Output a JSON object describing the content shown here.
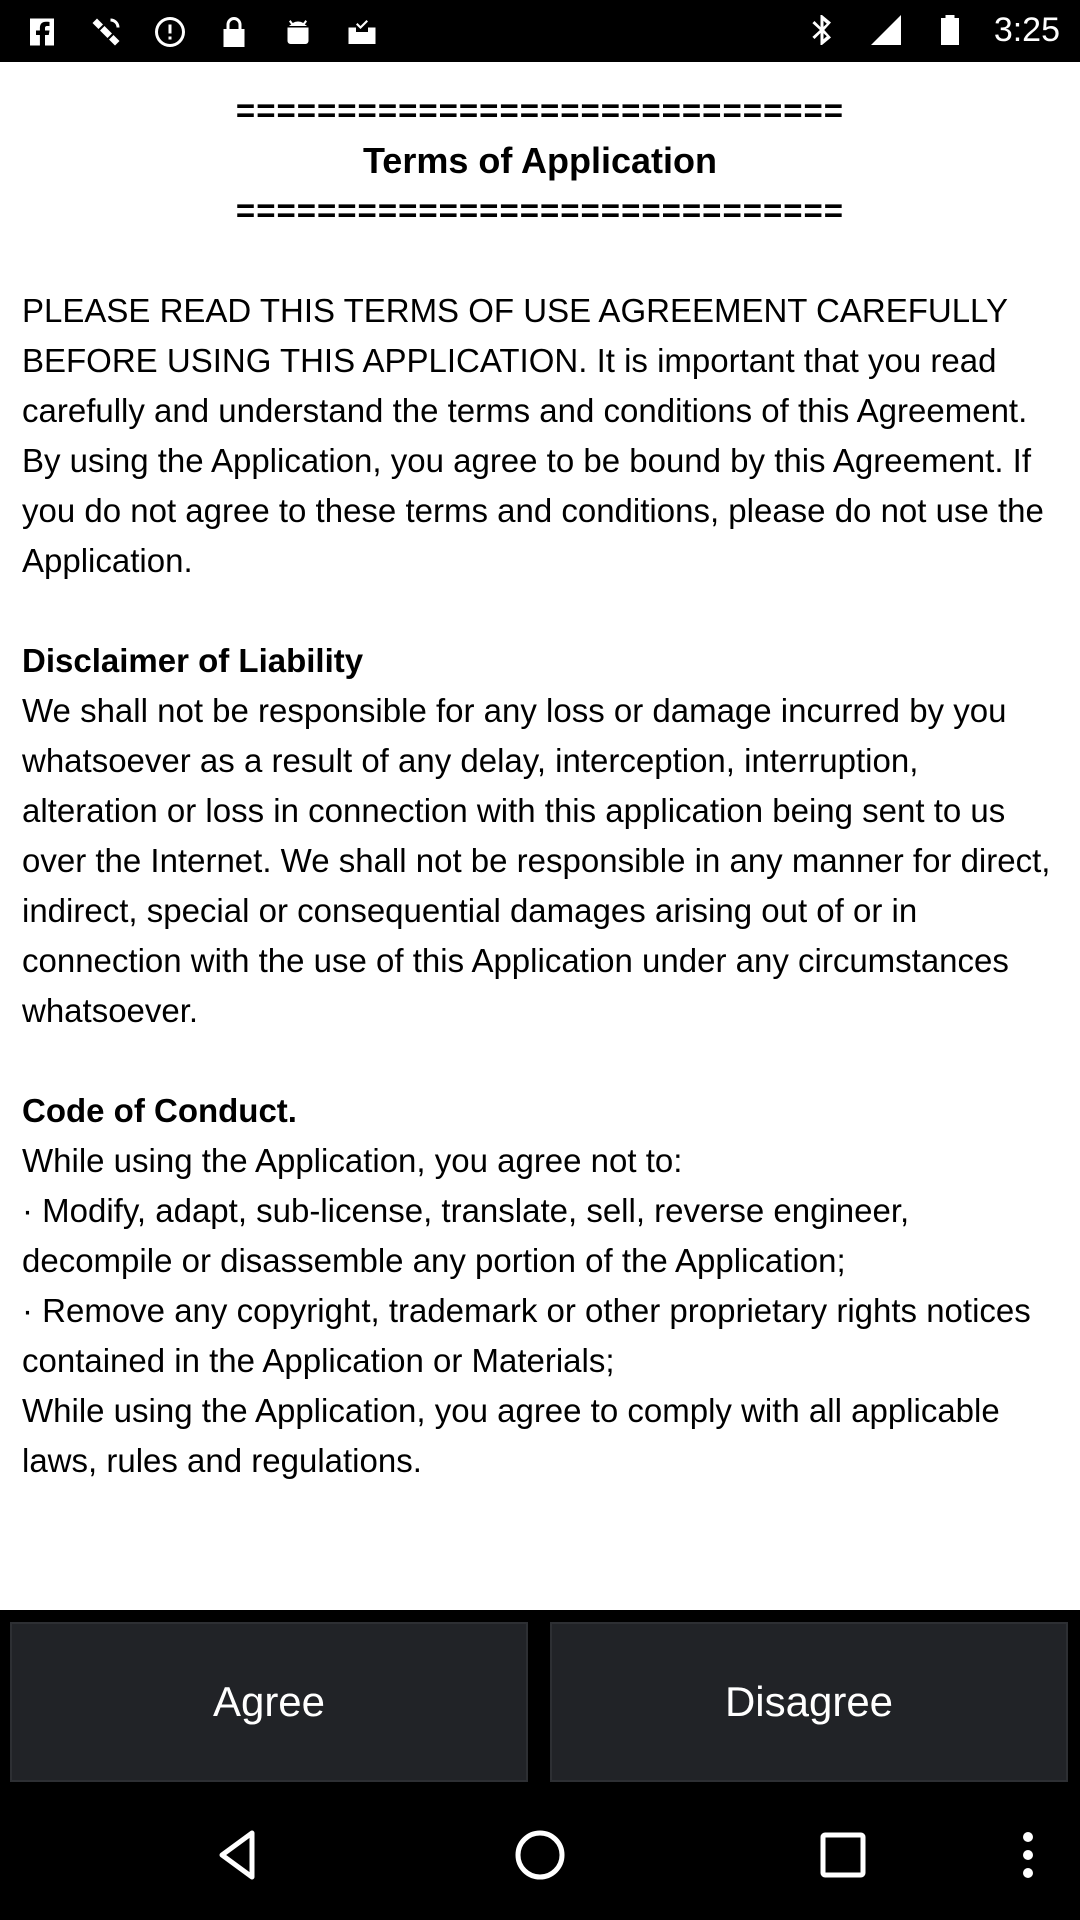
{
  "status_bar": {
    "time": "3:25",
    "left_icons": [
      "facebook-icon",
      "satellite-icon",
      "alert-circle-icon",
      "lock-icon",
      "android-icon",
      "inbox-check-icon"
    ],
    "right_icons": [
      "bluetooth-icon",
      "signal-icon",
      "battery-icon"
    ]
  },
  "document": {
    "separator_top": "==============================",
    "title": "Terms of Application",
    "separator_bottom": "==============================",
    "intro": "PLEASE READ THIS TERMS OF USE AGREEMENT CAREFULLY BEFORE USING THIS APPLICATION. It is important that you read carefully and understand the terms and conditions of this Agreement. By using the Application, you agree to be bound by this Agreement. If you do not agree to these terms and conditions, please do not use the Application.",
    "disclaimer_heading": "Disclaimer of Liability",
    "disclaimer_body": "We shall not be responsible for any loss or damage incurred by you whatsoever as a result of any delay, interception, interruption, alteration or loss in connection with this application being sent to us over the Internet. We shall not be responsible in any manner for direct, indirect, special or consequential damages arising out of or in connection with the use of this Application under any circumstances whatsoever.",
    "conduct_heading": "Code of Conduct.",
    "conduct_intro": "While using the Application, you agree not to:",
    "conduct_item_1": "· Modify, adapt, sub-license, translate, sell, reverse engineer, decompile or disassemble any portion of the Application;",
    "conduct_item_2": "· Remove any copyright, trademark or other proprietary rights notices contained in the Application or Materials;",
    "conduct_comply": "While using the Application, you agree to comply with all applicable laws, rules and regulations."
  },
  "buttons": {
    "agree": "Agree",
    "disagree": "Disagree"
  },
  "nav_bar": {
    "icons": [
      "back-icon",
      "home-icon",
      "recents-icon",
      "overflow-menu-icon"
    ]
  }
}
